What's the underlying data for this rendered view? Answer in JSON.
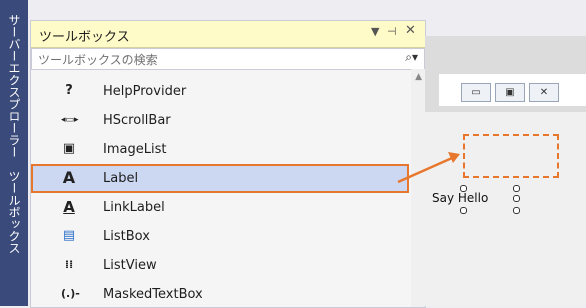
{
  "sidebar": {
    "tabs": [
      {
        "label": "サーバーエクスプローラー"
      },
      {
        "label": "ツールボックス"
      }
    ]
  },
  "toolbox": {
    "title": "ツールボックス",
    "pin_icon": "pin-icon",
    "close_icon": "close-icon",
    "search_placeholder": "ツールボックスの検索",
    "items": [
      {
        "label": "HelpProvider",
        "icon": "help-icon"
      },
      {
        "label": "HScrollBar",
        "icon": "hscrollbar-icon"
      },
      {
        "label": "ImageList",
        "icon": "imagelist-icon"
      },
      {
        "label": "Label",
        "icon": "label-icon",
        "selected": true
      },
      {
        "label": "LinkLabel",
        "icon": "linklabel-icon"
      },
      {
        "label": "ListBox",
        "icon": "listbox-icon"
      },
      {
        "label": "ListView",
        "icon": "listview-icon"
      },
      {
        "label": "MaskedTextBox",
        "icon": "maskedtextbox-icon"
      }
    ]
  },
  "designer": {
    "placed_label_text": "Say Hello"
  },
  "colors": {
    "accent": "#e8772e",
    "selection": "#ccd8f2",
    "sidebar": "#3a4a7a"
  }
}
